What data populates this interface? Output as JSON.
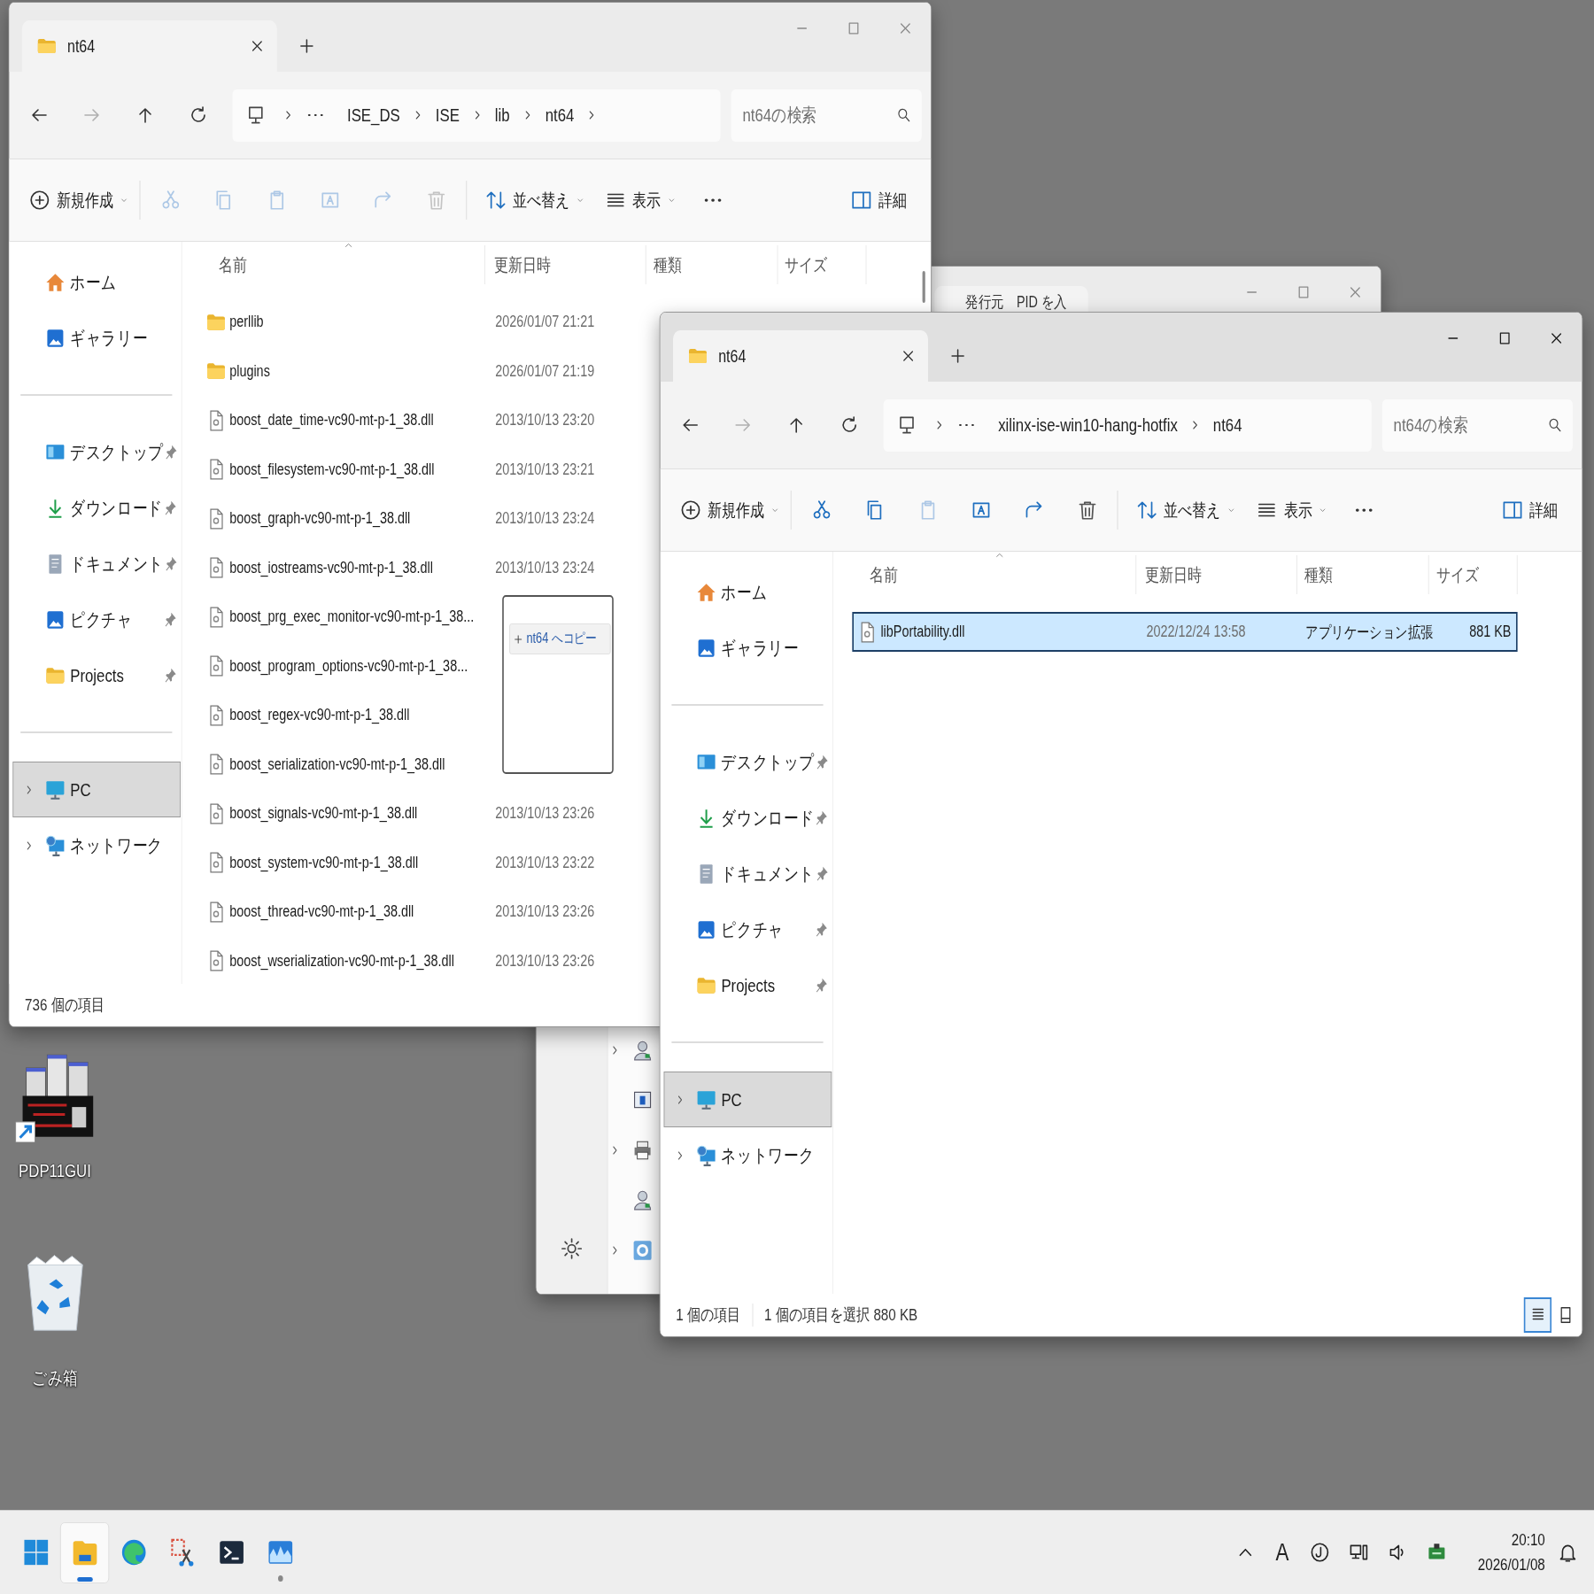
{
  "desktop_icons": [
    {
      "label": "PDP11GUI",
      "kind": "app_shortcut"
    },
    {
      "label": "ごみ箱",
      "kind": "recycle_bin"
    }
  ],
  "background_window": {
    "active": false,
    "tab_title": "発行元　PID を入",
    "nav_items": [
      {
        "kind": "user",
        "expandable": true
      },
      {
        "kind": "window",
        "expandable": false
      },
      {
        "kind": "printer",
        "expandable": true
      },
      {
        "kind": "user",
        "expandable": false
      },
      {
        "kind": "settings",
        "expandable": true
      }
    ]
  },
  "windows": [
    {
      "active": false,
      "tab": {
        "title": "nt64"
      },
      "forward_disabled": true,
      "breadcrumbs": [
        "ISE_DS",
        "ISE",
        "lib",
        "nt64"
      ],
      "trailing_chevron": true,
      "search": {
        "placeholder": "nt64の検索"
      },
      "toolbar": {
        "new_label": "新規作成",
        "actions": [
          {
            "kind": "cut",
            "disabled": true
          },
          {
            "kind": "copy",
            "disabled": true
          },
          {
            "kind": "paste",
            "disabled": true
          },
          {
            "kind": "rename",
            "disabled": true
          },
          {
            "kind": "share",
            "disabled": true
          },
          {
            "kind": "delete",
            "disabled": true
          }
        ],
        "sort_label": "並べ替え",
        "view_label": "表示",
        "details_label": "詳細"
      },
      "sidebar": {
        "groups": [
          [
            {
              "label": "ホーム",
              "kind": "home",
              "pinned": false,
              "expandable": false,
              "selected": false
            },
            {
              "label": "ギャラリー",
              "kind": "gallery",
              "pinned": false,
              "expandable": false,
              "selected": false
            }
          ],
          [
            {
              "label": "デスクトップ",
              "kind": "desktop",
              "pinned": true,
              "expandable": false,
              "selected": false
            },
            {
              "label": "ダウンロード",
              "kind": "download",
              "pinned": true,
              "expandable": false,
              "selected": false
            },
            {
              "label": "ドキュメント",
              "kind": "documents",
              "pinned": true,
              "expandable": false,
              "selected": false
            },
            {
              "label": "ピクチャ",
              "kind": "pictures",
              "pinned": true,
              "expandable": false,
              "selected": false
            },
            {
              "label": "Projects",
              "kind": "folder",
              "pinned": true,
              "expandable": false,
              "selected": false
            }
          ],
          [
            {
              "label": "PC",
              "kind": "pc",
              "pinned": false,
              "expandable": true,
              "selected": true
            },
            {
              "label": "ネットワーク",
              "kind": "network",
              "pinned": false,
              "expandable": true,
              "selected": false
            }
          ]
        ]
      },
      "columns": [
        "名前",
        "更新日時",
        "種類",
        "サイズ"
      ],
      "rows": [
        {
          "name": "perllib",
          "kind": "folder",
          "modified": "2026/01/07 21:21",
          "selected": false
        },
        {
          "name": "plugins",
          "kind": "folder",
          "modified": "2026/01/07 21:19",
          "selected": false
        },
        {
          "name": "boost_date_time-vc90-mt-p-1_38.dll",
          "kind": "file",
          "modified": "2013/10/13 23:20",
          "selected": false
        },
        {
          "name": "boost_filesystem-vc90-mt-p-1_38.dll",
          "kind": "file",
          "modified": "2013/10/13 23:21",
          "selected": false
        },
        {
          "name": "boost_graph-vc90-mt-p-1_38.dll",
          "kind": "file",
          "modified": "2013/10/13 23:24",
          "selected": false
        },
        {
          "name": "boost_iostreams-vc90-mt-p-1_38.dll",
          "kind": "file",
          "modified": "2013/10/13 23:24",
          "selected": false
        },
        {
          "name": "boost_prg_exec_monitor-vc90-mt-p-1_38...",
          "kind": "file",
          "selected": false
        },
        {
          "name": "boost_program_options-vc90-mt-p-1_38...",
          "kind": "file",
          "selected": false
        },
        {
          "name": "boost_regex-vc90-mt-p-1_38.dll",
          "kind": "file",
          "selected": false
        },
        {
          "name": "boost_serialization-vc90-mt-p-1_38.dll",
          "kind": "file",
          "selected": false
        },
        {
          "name": "boost_signals-vc90-mt-p-1_38.dll",
          "kind": "file",
          "modified": "2013/10/13 23:26",
          "selected": false
        },
        {
          "name": "boost_system-vc90-mt-p-1_38.dll",
          "kind": "file",
          "modified": "2013/10/13 23:22",
          "selected": false
        },
        {
          "name": "boost_thread-vc90-mt-p-1_38.dll",
          "kind": "file",
          "modified": "2013/10/13 23:26",
          "selected": false
        },
        {
          "name": "boost_wserialization-vc90-mt-p-1_38.dll",
          "kind": "file",
          "modified": "2013/10/13 23:26",
          "selected": false
        }
      ],
      "drag_tooltip": {
        "label": "nt64 へコピー"
      },
      "status": [
        "736 個の項目"
      ]
    },
    {
      "active": true,
      "tab": {
        "title": "nt64"
      },
      "forward_disabled": true,
      "breadcrumbs": [
        "xilinx-ise-win10-hang-hotfix",
        "nt64"
      ],
      "trailing_chevron": false,
      "search": {
        "placeholder": "nt64の検索"
      },
      "toolbar": {
        "new_label": "新規作成",
        "actions": [
          {
            "kind": "cut",
            "disabled": false
          },
          {
            "kind": "copy",
            "disabled": false
          },
          {
            "kind": "paste",
            "disabled": true
          },
          {
            "kind": "rename",
            "disabled": false
          },
          {
            "kind": "share",
            "disabled": false
          },
          {
            "kind": "delete",
            "disabled": false
          }
        ],
        "sort_label": "並べ替え",
        "view_label": "表示",
        "details_label": "詳細"
      },
      "sidebar": {
        "groups": [
          [
            {
              "label": "ホーム",
              "kind": "home",
              "pinned": false,
              "expandable": false,
              "selected": false
            },
            {
              "label": "ギャラリー",
              "kind": "gallery",
              "pinned": false,
              "expandable": false,
              "selected": false
            }
          ],
          [
            {
              "label": "デスクトップ",
              "kind": "desktop",
              "pinned": true,
              "expandable": false,
              "selected": false
            },
            {
              "label": "ダウンロード",
              "kind": "download",
              "pinned": true,
              "expandable": false,
              "selected": false
            },
            {
              "label": "ドキュメント",
              "kind": "documents",
              "pinned": true,
              "expandable": false,
              "selected": false
            },
            {
              "label": "ピクチャ",
              "kind": "pictures",
              "pinned": true,
              "expandable": false,
              "selected": false
            },
            {
              "label": "Projects",
              "kind": "folder",
              "pinned": true,
              "expandable": false,
              "selected": false
            }
          ],
          [
            {
              "label": "PC",
              "kind": "pc",
              "pinned": false,
              "expandable": true,
              "selected": true
            },
            {
              "label": "ネットワーク",
              "kind": "network",
              "pinned": false,
              "expandable": true,
              "selected": false
            }
          ]
        ]
      },
      "columns": [
        "名前",
        "更新日時",
        "種類",
        "サイズ"
      ],
      "rows": [
        {
          "name": "libPortability.dll",
          "kind": "file",
          "modified": "2022/12/24 13:58",
          "type": "アプリケーション拡張",
          "size": "881 KB",
          "selected": true
        }
      ],
      "status": [
        "1 個の項目",
        "1 個の項目を選択  880 KB"
      ],
      "view_toggles": [
        {
          "kind": "details",
          "selected": true
        },
        {
          "kind": "tiles",
          "selected": false
        }
      ]
    }
  ],
  "taskbar": {
    "apps": [
      {
        "kind": "start",
        "active": false,
        "running": false
      },
      {
        "kind": "explorer",
        "active": true
      },
      {
        "kind": "edge",
        "active": false,
        "running": false
      },
      {
        "kind": "snip",
        "active": false,
        "running": false
      },
      {
        "kind": "terminal",
        "active": false,
        "running": false
      },
      {
        "kind": "wave",
        "active": false,
        "running": true
      }
    ],
    "tray": [
      {
        "kind": "chevron"
      },
      {
        "kind": "ime",
        "text": "A"
      },
      {
        "kind": "ring"
      },
      {
        "kind": "monitor"
      },
      {
        "kind": "speaker"
      },
      {
        "kind": "battery"
      }
    ],
    "time": "20:10",
    "date": "2026/01/08"
  }
}
